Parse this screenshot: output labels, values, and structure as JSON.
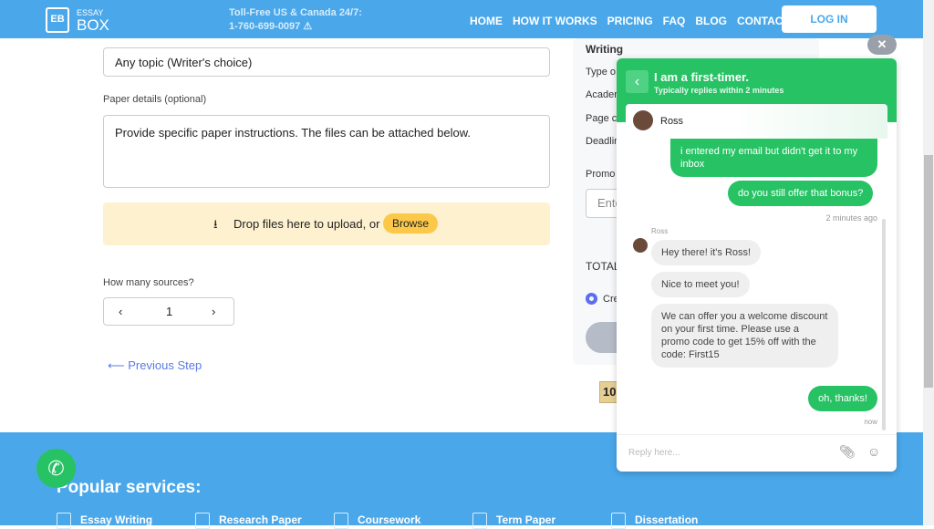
{
  "header": {
    "logo_mark": "EB",
    "logo_top": "ESSAY",
    "logo_bottom": "BOX",
    "tollfree": "Toll-Free US & Canada 24/7:",
    "phone": "1-760-699-0097",
    "nav": [
      "HOME",
      "HOW IT WORKS",
      "PRICING",
      "FAQ",
      "BLOG",
      "CONTACT US"
    ],
    "login": "LOG IN"
  },
  "form": {
    "topic_value": "Any topic (Writer's choice)",
    "details_label": "Paper details (optional)",
    "details_placeholder": "Provide specific paper instructions. The files can be attached below.",
    "drop_text": "Drop files here to upload, or",
    "browse": "Browse",
    "sources_label": "How many sources?",
    "sources_value": "1",
    "prev": "Previous Step"
  },
  "summary": {
    "title": "Writing",
    "rows": [
      "Type o",
      "Acader",
      "Page c",
      "Deadlir"
    ],
    "promo_label": "Promo",
    "promo_placeholder": "Ente",
    "total": "TOTAL",
    "radio": "Cre",
    "badge": "10"
  },
  "chat": {
    "title": "I am a first-timer.",
    "subtitle": "Typically replies within 2 minutes",
    "agent": "Ross",
    "m1": "i entered my email but didn't get it to my inbox",
    "m2": "do you still offer that bonus?",
    "time1": "2 minutes ago",
    "sender": "Ross",
    "r1": "Hey there! it's Ross!",
    "r2": "Nice to meet you!",
    "r3": "We can offer you a welcome discount on your first time. Please use a promo code to get 15% off with the code: First15",
    "m3": "oh, thanks!",
    "time2": "now",
    "reply_placeholder": "Reply here..."
  },
  "footer": {
    "title": "Popular services:",
    "services": [
      "Essay Writing",
      "Research Paper",
      "Coursework",
      "Term Paper",
      "Dissertation"
    ]
  },
  "colors": {
    "header": "#4aa8ea",
    "chat_green": "#27c264",
    "drop_bg": "#fdf1d0",
    "browse": "#fbc84a"
  }
}
